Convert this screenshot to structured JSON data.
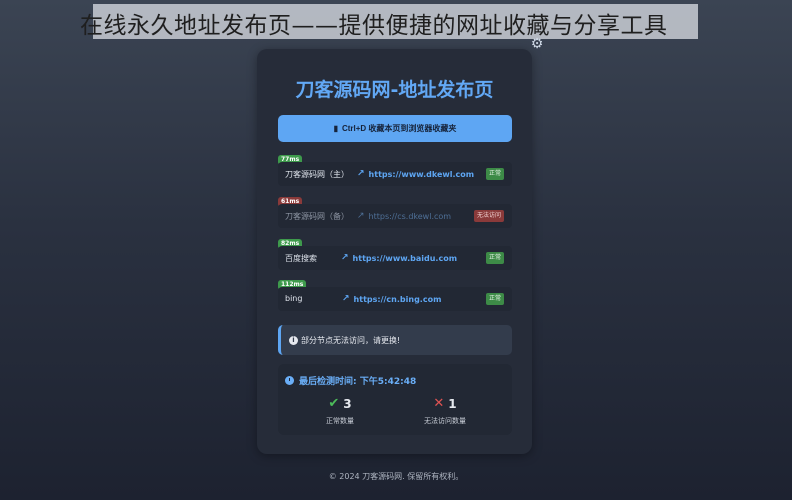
{
  "overlay_title": "在线永久地址发布页——提供便捷的网址收藏与分享工具",
  "card": {
    "title": "刀客源码网-地址发布页",
    "bookmark_button": "Ctrl+D 收藏本页到浏览器收藏夹"
  },
  "sites": [
    {
      "latency": "77ms",
      "name": "刀客源码网（主）",
      "url": "https://www.dkewl.com",
      "status": "正常",
      "ok": true
    },
    {
      "latency": "61ms",
      "name": "刀客源码网（备）",
      "url": "https://cs.dkewl.com",
      "status": "无法访问",
      "ok": false
    },
    {
      "latency": "82ms",
      "name": "百度搜索",
      "url": "https://www.baidu.com",
      "status": "正常",
      "ok": true
    },
    {
      "latency": "112ms",
      "name": "bing",
      "url": "https://cn.bing.com",
      "status": "正常",
      "ok": true
    }
  ],
  "notice": "部分节点无法访问，请更换!",
  "check": {
    "label": "最后检测时间: 下午5:42:48",
    "ok_count": "3",
    "ok_label": "正常数量",
    "bad_count": "1",
    "bad_label": "无法访问数量"
  },
  "footer": "© 2024 刀客源码网. 保留所有权利。",
  "colors": {
    "accent": "#5ea6f3",
    "ok": "#3d8b47",
    "bad": "#8a3a3a"
  },
  "icons": {
    "settings": "gear-icon",
    "bookmark": "bookmark-icon",
    "external_link": "external-link-icon",
    "info": "info-icon",
    "clock": "clock-icon",
    "ok": "check-icon",
    "bad": "cross-icon"
  }
}
